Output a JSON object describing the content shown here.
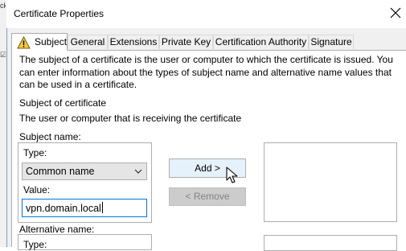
{
  "dialog": {
    "title": "Certificate Properties"
  },
  "tabs": [
    {
      "label": "Subject",
      "active": true
    },
    {
      "label": "General"
    },
    {
      "label": "Extensions"
    },
    {
      "label": "Private Key"
    },
    {
      "label": "Certification Authority"
    },
    {
      "label": "Signature"
    }
  ],
  "description": "The subject of a certificate is the user or computer to which the certificate is issued. You can enter information about the types of subject name and alternative name values that can be used in a certificate.",
  "subject_section": {
    "heading": "Subject of certificate",
    "subheading": "The user or computer that is receiving the certificate",
    "subject_name_label": "Subject name:",
    "type_label": "Type:",
    "type_value": "Common name",
    "value_label": "Value:",
    "value_text": "vpn.domain.local"
  },
  "buttons": {
    "add": "Add >",
    "remove": "< Remove"
  },
  "alternative_section": {
    "label": "Alternative name:",
    "type_label": "Type:"
  },
  "icons": {
    "tab_warning": "warning-icon",
    "close": "close-icon",
    "dropdown": "chevron-down-icon",
    "cursor": "mouse-pointer-icon"
  },
  "colors": {
    "focus_border": "#0078d7",
    "warning_fill": "#f7c93c"
  }
}
